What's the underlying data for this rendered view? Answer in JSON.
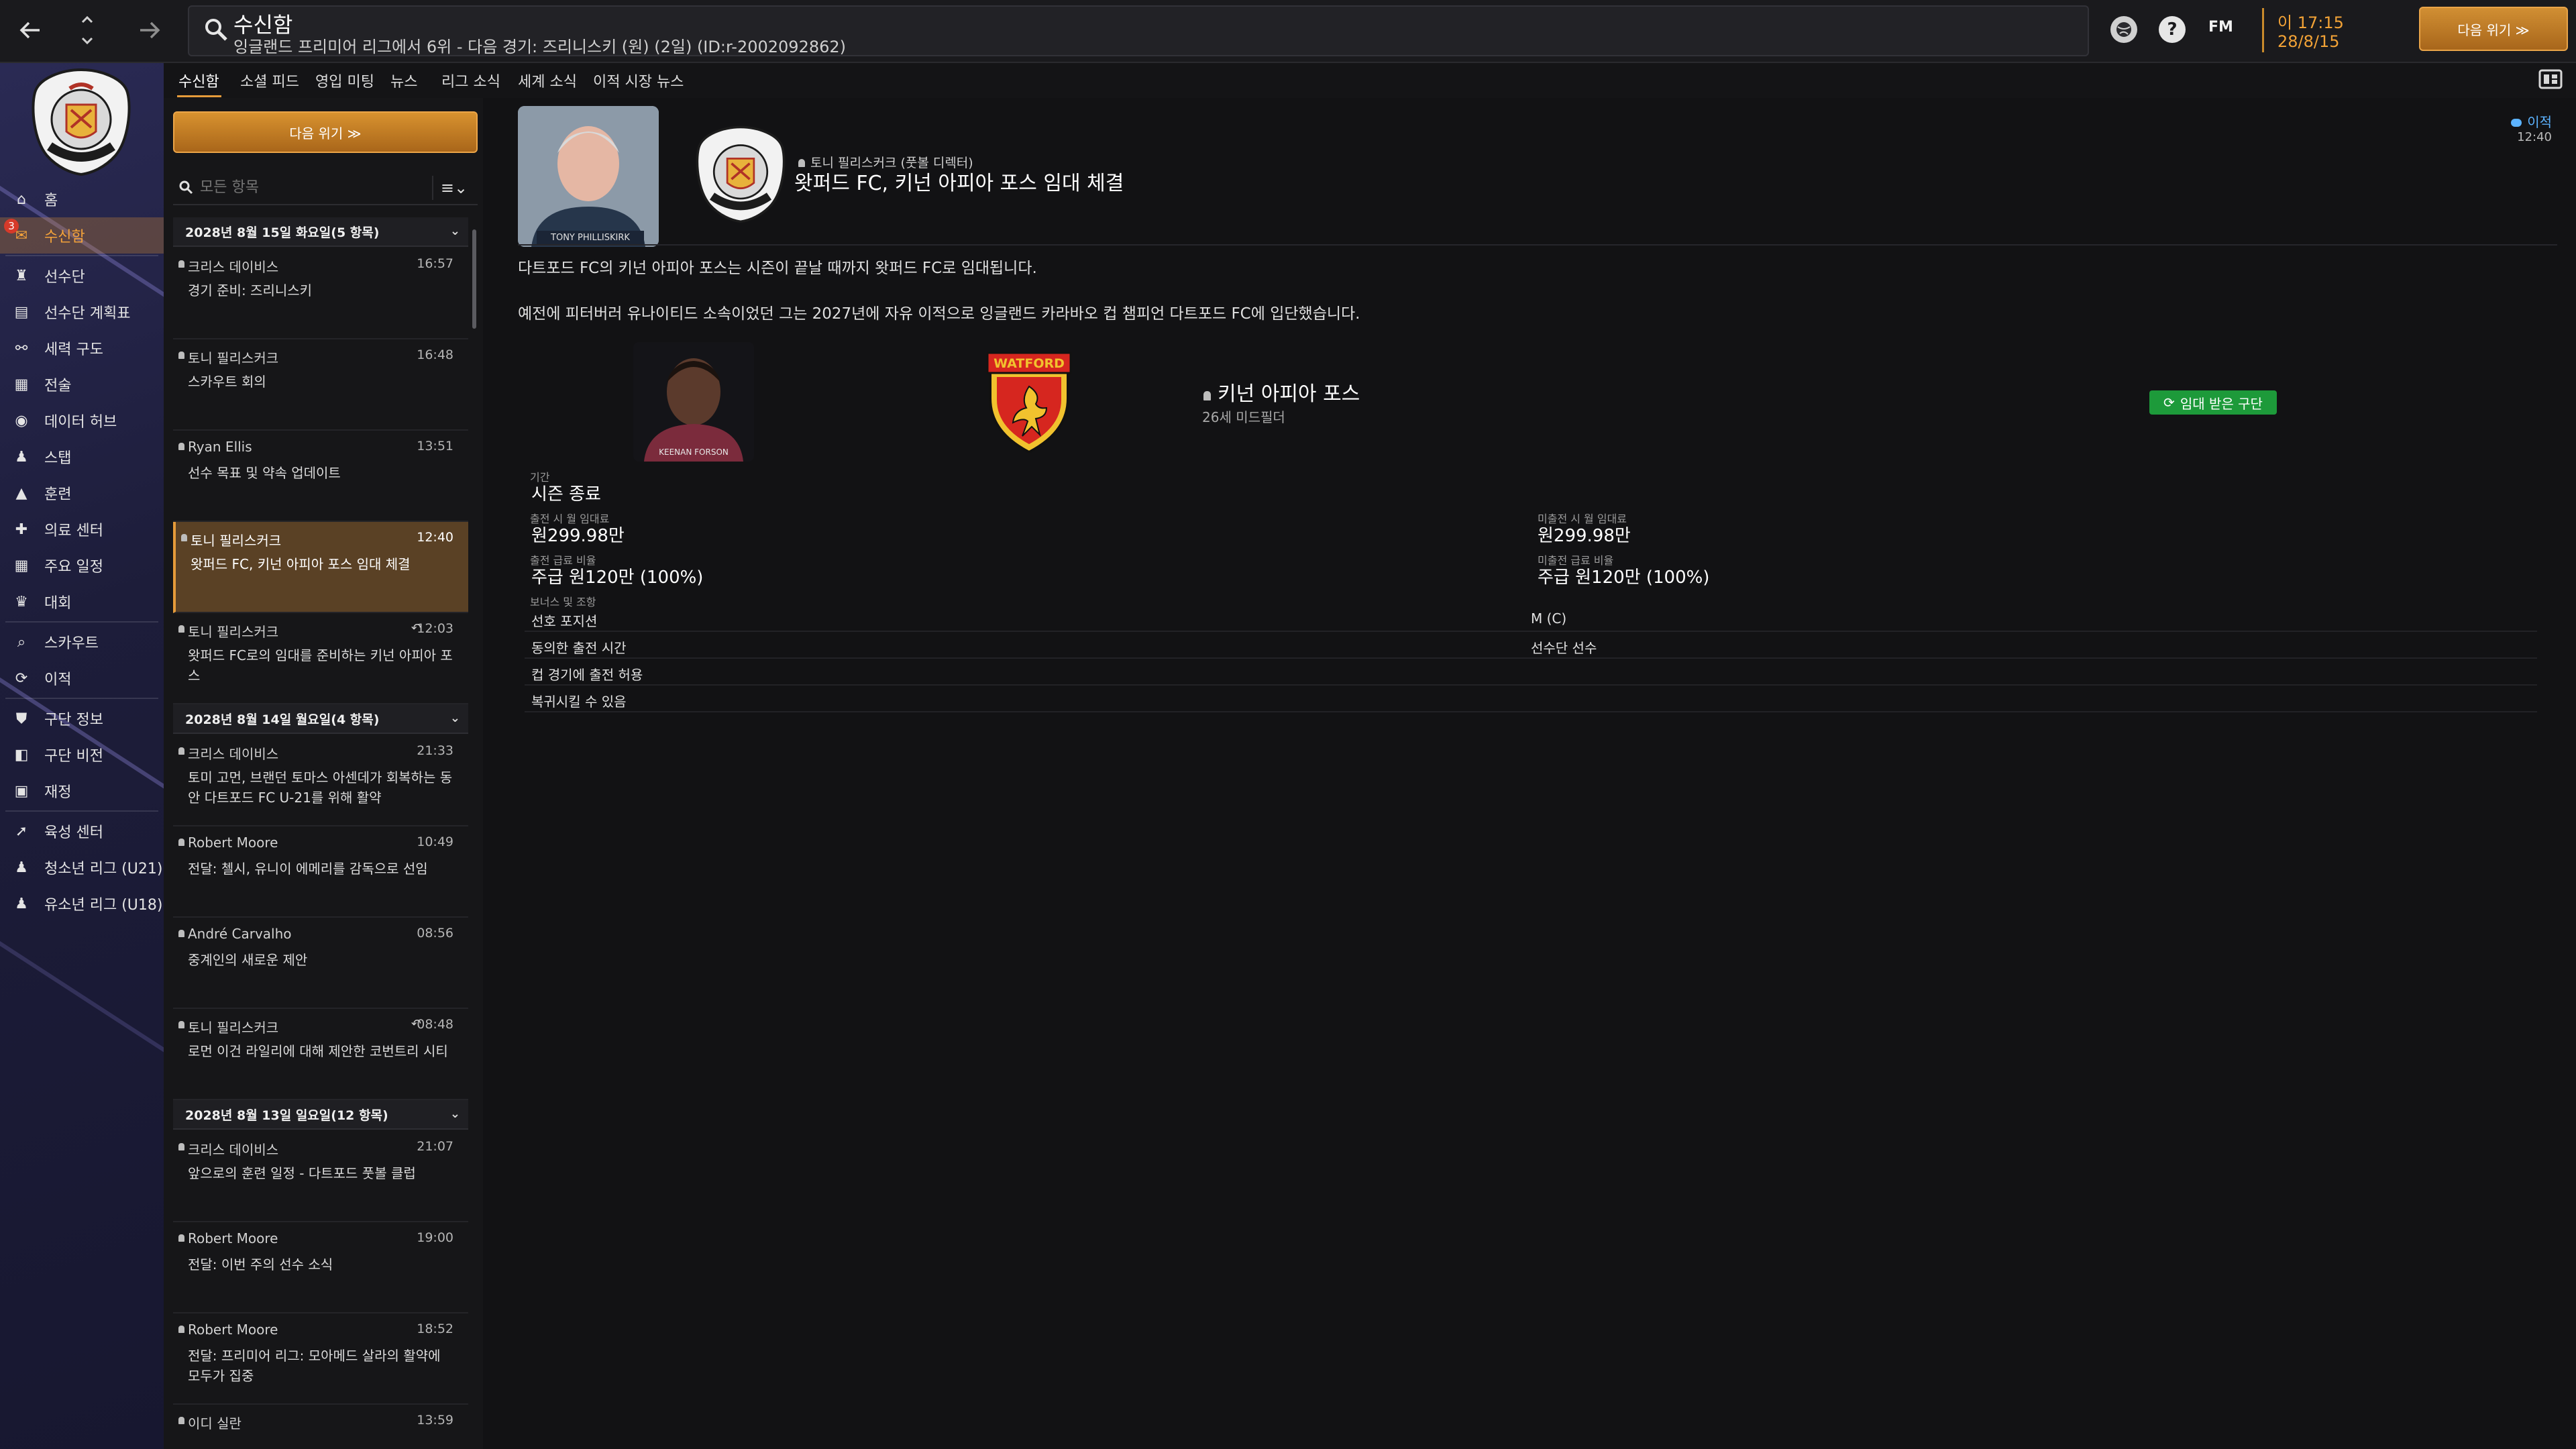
{
  "topbar": {
    "title": "수신함",
    "subtitle": "잉글랜드 프리미어 리그에서 6위 - 다음 경기: 즈리니스키 (원) (2일) (ID:r-2002092862)",
    "fm_label": "FM",
    "time": "이 17:15",
    "date": "28/8/15",
    "continue_label": "다음 위기 ≫"
  },
  "sidebar": {
    "inbox_badge": "3",
    "items": [
      {
        "label": "홈",
        "icon": "home-icon"
      },
      {
        "label": "수신함",
        "icon": "inbox-icon"
      },
      {
        "label": "선수단",
        "icon": "shirt-icon"
      },
      {
        "label": "선수단 계획표",
        "icon": "clipboard-icon"
      },
      {
        "label": "세력 구도",
        "icon": "hierarchy-icon"
      },
      {
        "label": "전술",
        "icon": "tactics-icon"
      },
      {
        "label": "데이터 허브",
        "icon": "data-hub-icon"
      },
      {
        "label": "스탭",
        "icon": "staff-icon"
      },
      {
        "label": "훈련",
        "icon": "training-icon"
      },
      {
        "label": "의료 센터",
        "icon": "medical-icon"
      },
      {
        "label": "주요 일정",
        "icon": "calendar-icon"
      },
      {
        "label": "대회",
        "icon": "trophy-icon"
      },
      {
        "label": "스카우트",
        "icon": "scout-icon"
      },
      {
        "label": "이적",
        "icon": "transfer-icon"
      },
      {
        "label": "구단 정보",
        "icon": "shield-icon"
      },
      {
        "label": "구단 비전",
        "icon": "vision-icon"
      },
      {
        "label": "재정",
        "icon": "finance-icon"
      },
      {
        "label": "육성 센터",
        "icon": "development-icon"
      },
      {
        "label": "청소년 리그 (U21)",
        "icon": "u21-icon"
      },
      {
        "label": "유소년 리그 (U18)",
        "icon": "u18-icon"
      }
    ]
  },
  "tabs": [
    "수신함",
    "소셜 피드",
    "영입 미팅",
    "뉴스",
    "리그 소식",
    "세계 소식",
    "이적 시장 뉴스"
  ],
  "list": {
    "continue_label": "다음 위기 ≫",
    "filter_placeholder": "모든 항목",
    "sort_label": "≡⌄",
    "groups": [
      {
        "header": "2028년 8월 15일 화요일(5 항목)",
        "messages": [
          {
            "sender": "크리스 데이비스",
            "time": "16:57",
            "subject": "경기 준비: 즈리니스키"
          },
          {
            "sender": "토니 필리스커크",
            "time": "16:48",
            "subject": "스카우트 회의"
          },
          {
            "sender": "Ryan Ellis",
            "time": "13:51",
            "subject": "선수 목표 및 약속 업데이트"
          },
          {
            "sender": "토니 필리스커크",
            "time": "12:40",
            "subject": "왓퍼드 FC, 키넌 아피아 포스 임대 체결"
          },
          {
            "sender": "토니 필리스커크",
            "time": "12:03",
            "subject": "왓퍼드 FC로의 임대를 준비하는 키넌 아피아 포스"
          }
        ]
      },
      {
        "header": "2028년 8월 14일 월요일(4 항목)",
        "messages": [
          {
            "sender": "크리스 데이비스",
            "time": "21:33",
            "subject": "토미 고먼, 브랜던 토마스 아센데가 회복하는 동안 다트포드 FC U-21를 위해 활약"
          },
          {
            "sender": "Robert Moore",
            "time": "10:49",
            "subject": "전달: 첼시, 유니이 에메리를 감독으로 선임"
          },
          {
            "sender": "André Carvalho",
            "time": "08:56",
            "subject": "중계인의 새로운 제안"
          },
          {
            "sender": "토니 필리스커크",
            "time": "08:48",
            "subject": "로먼 이건 라일리에 대해 제안한 코번트리 시티"
          }
        ]
      },
      {
        "header": "2028년 8월 13일 일요일(12 항목)",
        "messages": [
          {
            "sender": "크리스 데이비스",
            "time": "21:07",
            "subject": "앞으로의 훈련 일정 - 다트포드 풋볼 클럽"
          },
          {
            "sender": "Robert Moore",
            "time": "19:00",
            "subject": "전달: 이번 주의 선수 소식"
          },
          {
            "sender": "Robert Moore",
            "time": "18:52",
            "subject": "전달: 프리미어 리그: 모아메드 살라의 활약에 모두가 집중"
          },
          {
            "sender": "이디 실란",
            "time": "13:59",
            "subject": ""
          }
        ]
      }
    ]
  },
  "message": {
    "from": "토니 필리스커크 (풋볼 디렉터)",
    "headline": "왓퍼드 FC, 키넌 아피아 포스 임대 체결",
    "move_link": "이적",
    "time": "12:40",
    "photo_caption": "TONY PHILLISKIRK",
    "para1": "다트포드 FC의 키넌 아피아 포스는 시즌이 끝날 때까지 왓퍼드 FC로 임대됩니다.",
    "para2": "예전에 피터버러 유나이티드 소속이었던 그는 2027년에 자유 이적으로 잉글랜드 카라바오 컵 챔피언 다트포드 FC에 입단했습니다.",
    "watford_label": "WATFORD",
    "player": {
      "name": "키넌 아피아 포스",
      "meta": "26세 미드필더",
      "photo_caption": "KEENAN FORSON",
      "loan_badge": "임대 받은 구단"
    },
    "terms": {
      "period_label": "기간",
      "period_value": "시즌 종료",
      "fee_played_label": "출전 시 월 임대료",
      "fee_played_value": "원299.98만",
      "fee_unplayed_label": "미출전 시 월 임대료",
      "fee_unplayed_value": "원299.98만",
      "wage_played_label": "출전 급료 비율",
      "wage_played_value": "주급 원120만 (100%)",
      "wage_unplayed_label": "미출전 급료 비율",
      "wage_unplayed_value": "주급 원120만 (100%)",
      "clauses_label": "보너스 및 조항",
      "rows": [
        {
          "a": "선호 포지션",
          "b": "M (C)"
        },
        {
          "a": "동의한 출전 시간",
          "b": "선수단 선수"
        },
        {
          "a": "컵 경기에 출전 허용",
          "b": ""
        },
        {
          "a": "복귀시킬 수 있음",
          "b": ""
        }
      ]
    }
  },
  "colors": {
    "accent": "#e59b3a",
    "sidebar": "#1d1d3a",
    "loan_green": "#1d9a3a",
    "link_blue": "#5cb3ff"
  }
}
